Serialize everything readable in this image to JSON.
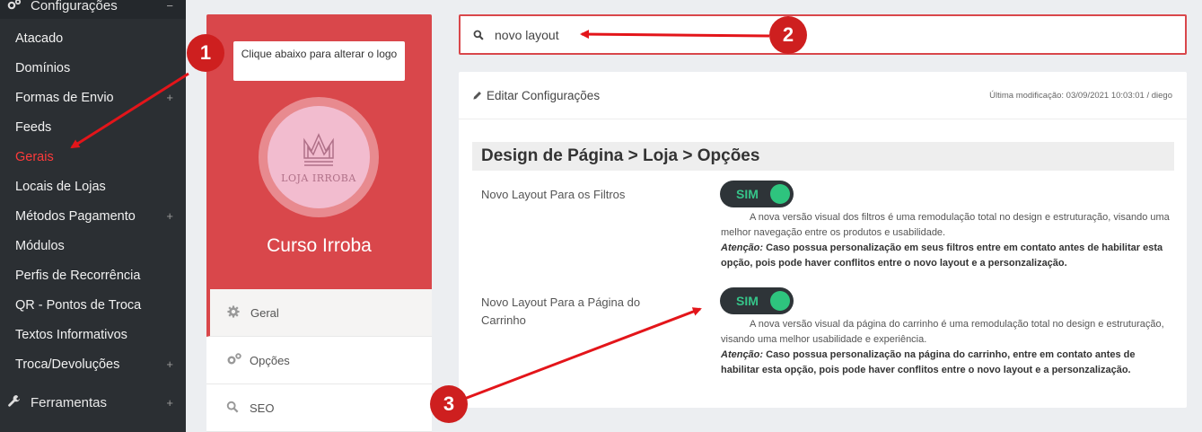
{
  "sidebar": {
    "section_title": "Configurações",
    "items": [
      {
        "label": "Atacado",
        "expandable": false
      },
      {
        "label": "Domínios",
        "expandable": false
      },
      {
        "label": "Formas de Envio",
        "expandable": true
      },
      {
        "label": "Feeds",
        "expandable": false
      },
      {
        "label": "Gerais",
        "expandable": false,
        "active": true
      },
      {
        "label": "Locais de Lojas",
        "expandable": false
      },
      {
        "label": "Métodos Pagamento",
        "expandable": true
      },
      {
        "label": "Módulos",
        "expandable": false
      },
      {
        "label": "Perfis de Recorrência",
        "expandable": false
      },
      {
        "label": "QR - Pontos de Troca",
        "expandable": false
      },
      {
        "label": "Textos Informativos",
        "expandable": false
      },
      {
        "label": "Troca/Devoluções",
        "expandable": true
      }
    ],
    "tools_label": "Ferramentas",
    "collapse_symbol": "−",
    "expand_symbol": "+"
  },
  "logo_panel": {
    "change_logo_label": "Clique abaixo para alterar o logo",
    "logo_text": "LOJA IRROBA",
    "course_name": "Curso Irroba"
  },
  "side_menu": [
    {
      "label": "Geral",
      "icon": "gear-icon",
      "active": true
    },
    {
      "label": "Opções",
      "icon": "gears-icon",
      "active": false
    },
    {
      "label": "SEO",
      "icon": "search-icon",
      "active": false
    }
  ],
  "search": {
    "value": "novo layout"
  },
  "card": {
    "title": "Editar Configurações",
    "last_modified": "Última modificação: 03/09/2021 10:03:01 / diego",
    "section_title": "Design de Página > Loja > Opções",
    "options": [
      {
        "label": "Novo Layout Para os Filtros",
        "toggle": "SIM",
        "description": "A nova versão visual dos filtros é uma remodulação total no design e estruturação, visando uma melhor navegação entre os produtos e usabilidade.",
        "warning_label": "Atenção:",
        "warning_text": "Caso possua personalização em seus filtros entre em contato antes de habilitar esta opção, pois pode haver conflitos entre o novo layout e a personzalização."
      },
      {
        "label": "Novo Layout Para a Página do Carrinho",
        "toggle": "SIM",
        "description": "A nova versão visual da página do carrinho é uma remodulação total no design e estruturação, visando uma melhor usabilidade e experiência.",
        "warning_label": "Atenção:",
        "warning_text": "Caso possua personalização na página do carrinho, entre em contato antes de habilitar esta opção, pois pode haver conflitos entre o novo layout e a personzalização."
      }
    ]
  },
  "annotations": {
    "badges": [
      "1",
      "2",
      "3"
    ],
    "color": "#ce1f1f"
  },
  "colors": {
    "sidebar_bg": "#2b2f33",
    "accent_red": "#d9474b",
    "active_item": "#ff3a3a",
    "toggle_on": "#2ec47e"
  }
}
